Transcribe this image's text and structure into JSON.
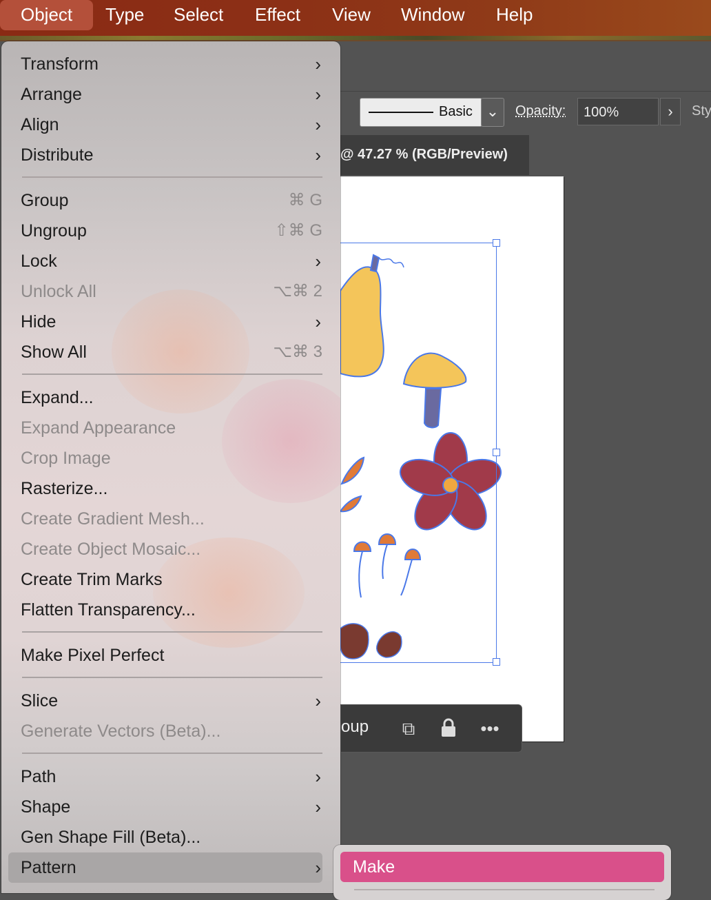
{
  "menubar": {
    "items": [
      "Object",
      "Type",
      "Select",
      "Effect",
      "View",
      "Window",
      "Help"
    ]
  },
  "controlbar": {
    "stroke_style": "Basic",
    "opacity_label": "Opacity:",
    "opacity_value": "100%",
    "style_label": "Sty"
  },
  "document_tab": {
    "title": "@ 47.27 % (RGB/Preview)"
  },
  "context_bar": {
    "label": "oup"
  },
  "object_menu": {
    "items": [
      {
        "label": "Transform",
        "submenu": true
      },
      {
        "label": "Arrange",
        "submenu": true
      },
      {
        "label": "Align",
        "submenu": true
      },
      {
        "label": "Distribute",
        "submenu": true
      },
      {
        "label": "Group",
        "shortcut": "⌘ G"
      },
      {
        "label": "Ungroup",
        "shortcut": "⇧⌘ G"
      },
      {
        "label": "Lock",
        "submenu": true
      },
      {
        "label": "Unlock All",
        "shortcut": "⌥⌘ 2",
        "disabled": true
      },
      {
        "label": "Hide",
        "submenu": true
      },
      {
        "label": "Show All",
        "shortcut": "⌥⌘ 3"
      },
      {
        "label": "Expand..."
      },
      {
        "label": "Expand Appearance",
        "disabled": true
      },
      {
        "label": "Crop Image",
        "disabled": true
      },
      {
        "label": "Rasterize..."
      },
      {
        "label": "Create Gradient Mesh...",
        "disabled": true
      },
      {
        "label": "Create Object Mosaic...",
        "disabled": true
      },
      {
        "label": "Create Trim Marks"
      },
      {
        "label": "Flatten Transparency..."
      },
      {
        "label": "Make Pixel Perfect"
      },
      {
        "label": "Slice",
        "submenu": true
      },
      {
        "label": "Generate Vectors (Beta)...",
        "disabled": true
      },
      {
        "label": "Path",
        "submenu": true
      },
      {
        "label": "Shape",
        "submenu": true
      },
      {
        "label": "Gen Shape Fill (Beta)..."
      },
      {
        "label": "Pattern",
        "submenu": true,
        "highlighted": true
      }
    ]
  },
  "pattern_submenu": {
    "items": [
      {
        "label": "Make",
        "highlighted": true
      }
    ]
  },
  "colors": {
    "menubar_active": "#b4503a",
    "submenu_highlight": "#d9508a",
    "selection": "#4a78e8"
  }
}
